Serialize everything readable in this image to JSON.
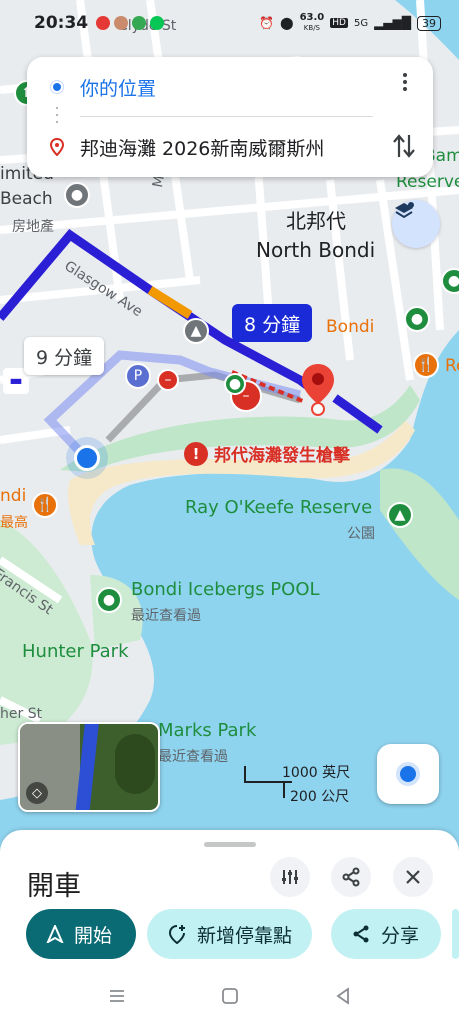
{
  "status_bar": {
    "time": "20:34",
    "network_speed": "63.0",
    "network_unit": "KB/S",
    "hd_label": "HD",
    "signal_label": "5G",
    "battery": "39"
  },
  "route_card": {
    "origin": "你的位置",
    "destination": "邦迪海灘 2026新南威爾斯州"
  },
  "map": {
    "labels": {
      "north_bondi_zh": "北邦代",
      "north_bondi_en": "North Bondi",
      "beach": "Beach",
      "beach_zh": "房地產",
      "limited": "imited",
      "glasgow_ave": "Glasgow Ave",
      "mitchell": "Mitc",
      "bondi_orange": "Bondi",
      "bondi_orange_left": "ndi",
      "most_high": "最高",
      "shooting_alert": "邦代海灘發生槍擊",
      "ray_okeefe": "Ray O'Keefe Reserve",
      "park_zh": "公園",
      "icebergs": "Bondi Icebergs POOL",
      "recently_viewed_1": "最近查看過",
      "hunter_park": "Hunter Park",
      "marks_park": "Marks Park",
      "recently_viewed_2": "最近查看過",
      "francis_st": "Francis St",
      "her_st": "her St",
      "bam": "Bam",
      "reserve": "Reserve",
      "re": "Re",
      "clyde_st": "Clyde St"
    },
    "duration_selected": "8 分鐘",
    "duration_alt": "9 分鐘",
    "scale_ft": "1000 英尺",
    "scale_m": "200 公尺",
    "colors": {
      "route": "#2b1fd6",
      "route_alt": "#7b8cf0",
      "water": "#8fd4ef",
      "park": "#bfe6c8",
      "sand": "#f6e9c9"
    }
  },
  "sheet": {
    "title": "開車",
    "start_label": "開始",
    "add_stop_label": "新增停靠點",
    "share_label": "分享"
  }
}
